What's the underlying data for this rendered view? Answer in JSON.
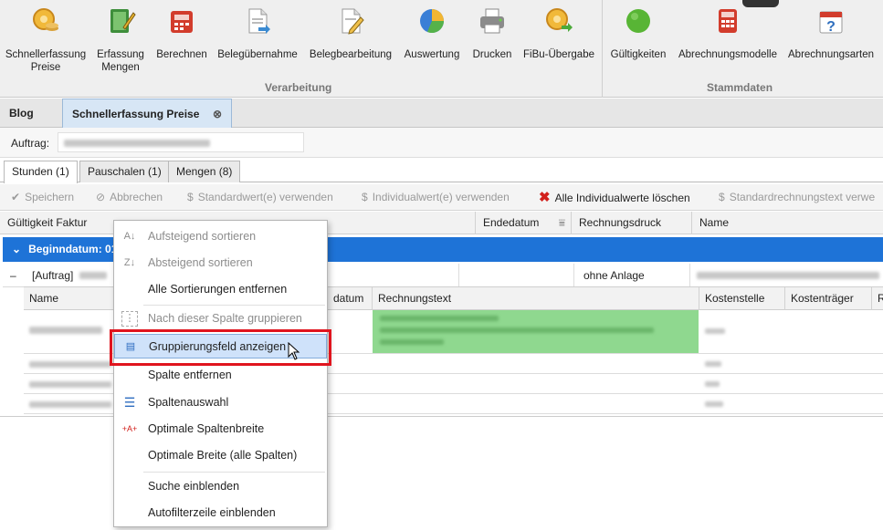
{
  "ribbon": {
    "buttons": [
      {
        "label": "Schnellerfassung\nPreise",
        "icon": "gear-coins-icon"
      },
      {
        "label": "Erfassung\nMengen",
        "icon": "notebook-pencil-icon"
      },
      {
        "label": "Berechnen",
        "icon": "calculator-red-icon"
      },
      {
        "label": "Belegübernahme",
        "icon": "document-import-icon"
      },
      {
        "label": "Belegbearbeitung",
        "icon": "document-edit-icon"
      },
      {
        "label": "Auswertung",
        "icon": "pie-chart-icon"
      },
      {
        "label": "Drucken",
        "icon": "printer-icon"
      },
      {
        "label": "FiBu-Übergabe",
        "icon": "coins-transfer-icon"
      },
      {
        "label": "Gültigkeiten",
        "icon": "green-circle-icon"
      },
      {
        "label": "Abrechnungsmodelle",
        "icon": "calculator-icon"
      },
      {
        "label": "Abrechnungsarten",
        "icon": "help-calendar-icon"
      }
    ],
    "group_verarbeitung": "Verarbeitung",
    "group_stammdaten": "Stammdaten"
  },
  "doc_tabs": {
    "blog": "Blog",
    "active": "Schnellerfassung Preise"
  },
  "order": {
    "label": "Auftrag:"
  },
  "sub_tabs": [
    "Stunden (1)",
    "Pauschalen (1)",
    "Mengen (8)"
  ],
  "toolbar": {
    "save": "Speichern",
    "cancel": "Abbrechen",
    "default_value": "Standardwert(e) verwenden",
    "individual_value": "Individualwert(e) verwenden",
    "delete_all": "Alle Individualwerte löschen",
    "default_text": "Standardrechnungstext verwe"
  },
  "columns": {
    "gueltigkeit": "Gültigkeit Faktur",
    "endedatum": "Endedatum",
    "rechnungsdruck": "Rechnungsdruck",
    "name": "Name"
  },
  "group_row": {
    "label": "Beginndatum: 01"
  },
  "data_row": {
    "auftrag": "[Auftrag]",
    "rechnungsdruck": "ohne Anlage"
  },
  "nested_columns": {
    "name": "Name",
    "datum": "datum",
    "rechnungstext": "Rechnungstext",
    "kostenstelle": "Kostenstelle",
    "kostentraeger": "Kostenträger",
    "r": "R"
  },
  "context_menu": {
    "sort_asc": "Aufsteigend sortieren",
    "sort_desc": "Absteigend sortieren",
    "clear_sort": "Alle Sortierungen entfernen",
    "group_by": "Nach dieser Spalte gruppieren",
    "show_group_panel": "Gruppierungsfeld anzeigen",
    "remove_column": "Spalte entfernen",
    "column_chooser": "Spaltenauswahl",
    "best_fit": "Optimale Spaltenbreite",
    "best_fit_all": "Optimale Breite (alle Spalten)",
    "show_find": "Suche einblenden",
    "show_autofilter": "Autofilterzeile einblenden"
  },
  "colors": {
    "group_row": "#1e73d7",
    "highlight": "#cfe2fa",
    "annotation": "#e0141e",
    "blurred_text_bg": "#8fd88f"
  }
}
